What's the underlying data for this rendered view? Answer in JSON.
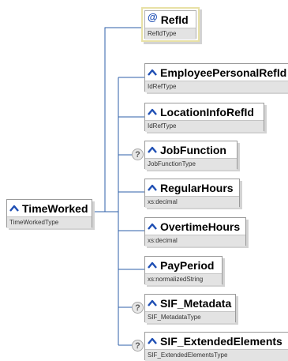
{
  "root": {
    "name": "TimeWorked",
    "type": "TimeWorkedType",
    "icon": "element-icon"
  },
  "attribute": {
    "name": "RefId",
    "type": "RefIdType",
    "prefix": "@",
    "icon": "attribute-icon"
  },
  "children": [
    {
      "name": "EmployeePersonalRefId",
      "type": "IdRefType",
      "optional": false,
      "icon": "element-icon"
    },
    {
      "name": "LocationInfoRefId",
      "type": "IdRefType",
      "optional": false,
      "icon": "element-icon"
    },
    {
      "name": "JobFunction",
      "type": "JobFunctionType",
      "optional": true,
      "icon": "element-icon"
    },
    {
      "name": "RegularHours",
      "type": "xs:decimal",
      "optional": false,
      "icon": "element-icon"
    },
    {
      "name": "OvertimeHours",
      "type": "xs:decimal",
      "optional": false,
      "icon": "element-icon"
    },
    {
      "name": "PayPeriod",
      "type": "xs:normalizedString",
      "optional": false,
      "icon": "element-icon"
    },
    {
      "name": "SIF_Metadata",
      "type": "SIF_MetadataType",
      "optional": true,
      "icon": "element-icon"
    },
    {
      "name": "SIF_ExtendedElements",
      "type": "SIF_ExtendedElementsType",
      "optional": true,
      "icon": "element-icon"
    }
  ],
  "optional_marker": "?",
  "colors": {
    "connector": "#2e5fa8",
    "icon": "#1f4fb4",
    "type_bar": "#e3e3e3",
    "attribute_border": "#e8e1a6"
  }
}
